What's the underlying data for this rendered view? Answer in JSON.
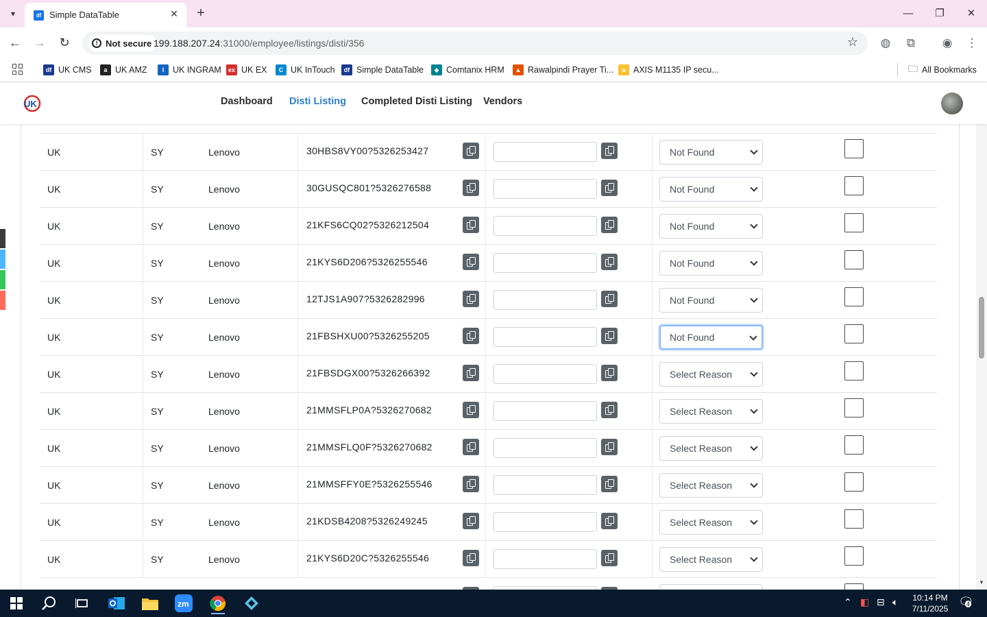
{
  "browser": {
    "tab_title": "Simple DataTable",
    "tab_favicon_text": "df",
    "security_label": "Not secure",
    "url_host": "199.188.207.24",
    "url_rest": ":31000/employee/listings/disti/356",
    "bookmarks": [
      {
        "label": "UK CMS",
        "color": "#1a3a8f",
        "glyph": "df"
      },
      {
        "label": "UK AMZ",
        "color": "#222222",
        "glyph": "a"
      },
      {
        "label": "UK INGRAM",
        "color": "#1565c0",
        "glyph": "I"
      },
      {
        "label": "UK EX",
        "color": "#d32f2f",
        "glyph": "ex"
      },
      {
        "label": "UK InTouch",
        "color": "#0288d1",
        "glyph": "C"
      },
      {
        "label": "Simple DataTable",
        "color": "#1a3a8f",
        "glyph": "df"
      },
      {
        "label": "Comtanix HRM",
        "color": "#00838f",
        "glyph": "◆"
      },
      {
        "label": "Rawalpindi Prayer Ti...",
        "color": "#e65100",
        "glyph": "▲"
      },
      {
        "label": "AXIS M1135 IP secu...",
        "color": "#fbc02d",
        "glyph": "a"
      }
    ],
    "all_bookmarks_label": "All Bookmarks"
  },
  "nav": {
    "items": [
      "Dashboard",
      "Disti Listing",
      "Completed Disti Listing",
      "Vendors"
    ],
    "active_index": 1
  },
  "table": {
    "rows": [
      {
        "country": "UK",
        "code": "SY",
        "brand": "Lenovo",
        "sku": "30HBS8VY00?5326253427",
        "reason": "Not Found"
      },
      {
        "country": "UK",
        "code": "SY",
        "brand": "Lenovo",
        "sku": "30GUSQC801?5326276588",
        "reason": "Not Found"
      },
      {
        "country": "UK",
        "code": "SY",
        "brand": "Lenovo",
        "sku": "21KFS6CQ02?5326212504",
        "reason": "Not Found"
      },
      {
        "country": "UK",
        "code": "SY",
        "brand": "Lenovo",
        "sku": "21KYS6D206?5326255546",
        "reason": "Not Found"
      },
      {
        "country": "UK",
        "code": "SY",
        "brand": "Lenovo",
        "sku": "12TJS1A907?5326282996",
        "reason": "Not Found"
      },
      {
        "country": "UK",
        "code": "SY",
        "brand": "Lenovo",
        "sku": "21FBSHXU00?5326255205",
        "reason": "Not Found",
        "focused": true
      },
      {
        "country": "UK",
        "code": "SY",
        "brand": "Lenovo",
        "sku": "21FBSDGX00?5326266392",
        "reason": "Select Reason"
      },
      {
        "country": "UK",
        "code": "SY",
        "brand": "Lenovo",
        "sku": "21MMSFLP0A?5326270682",
        "reason": "Select Reason"
      },
      {
        "country": "UK",
        "code": "SY",
        "brand": "Lenovo",
        "sku": "21MMSFLQ0F?5326270682",
        "reason": "Select Reason"
      },
      {
        "country": "UK",
        "code": "SY",
        "brand": "Lenovo",
        "sku": "21MMSFFY0E?5326255546",
        "reason": "Select Reason"
      },
      {
        "country": "UK",
        "code": "SY",
        "brand": "Lenovo",
        "sku": "21KDSB4208?5326249245",
        "reason": "Select Reason"
      },
      {
        "country": "UK",
        "code": "SY",
        "brand": "Lenovo",
        "sku": "21KYS6D20C?5326255546",
        "reason": "Select Reason"
      }
    ]
  },
  "taskbar": {
    "time": "10:14 PM",
    "date": "7/11/2025",
    "notification_count": "4"
  },
  "colors": {
    "accent": "#2f80c8",
    "tabstrip": "#f9e3f3",
    "copy_button": "#5a6268",
    "taskbar": "#0a1a2e"
  }
}
